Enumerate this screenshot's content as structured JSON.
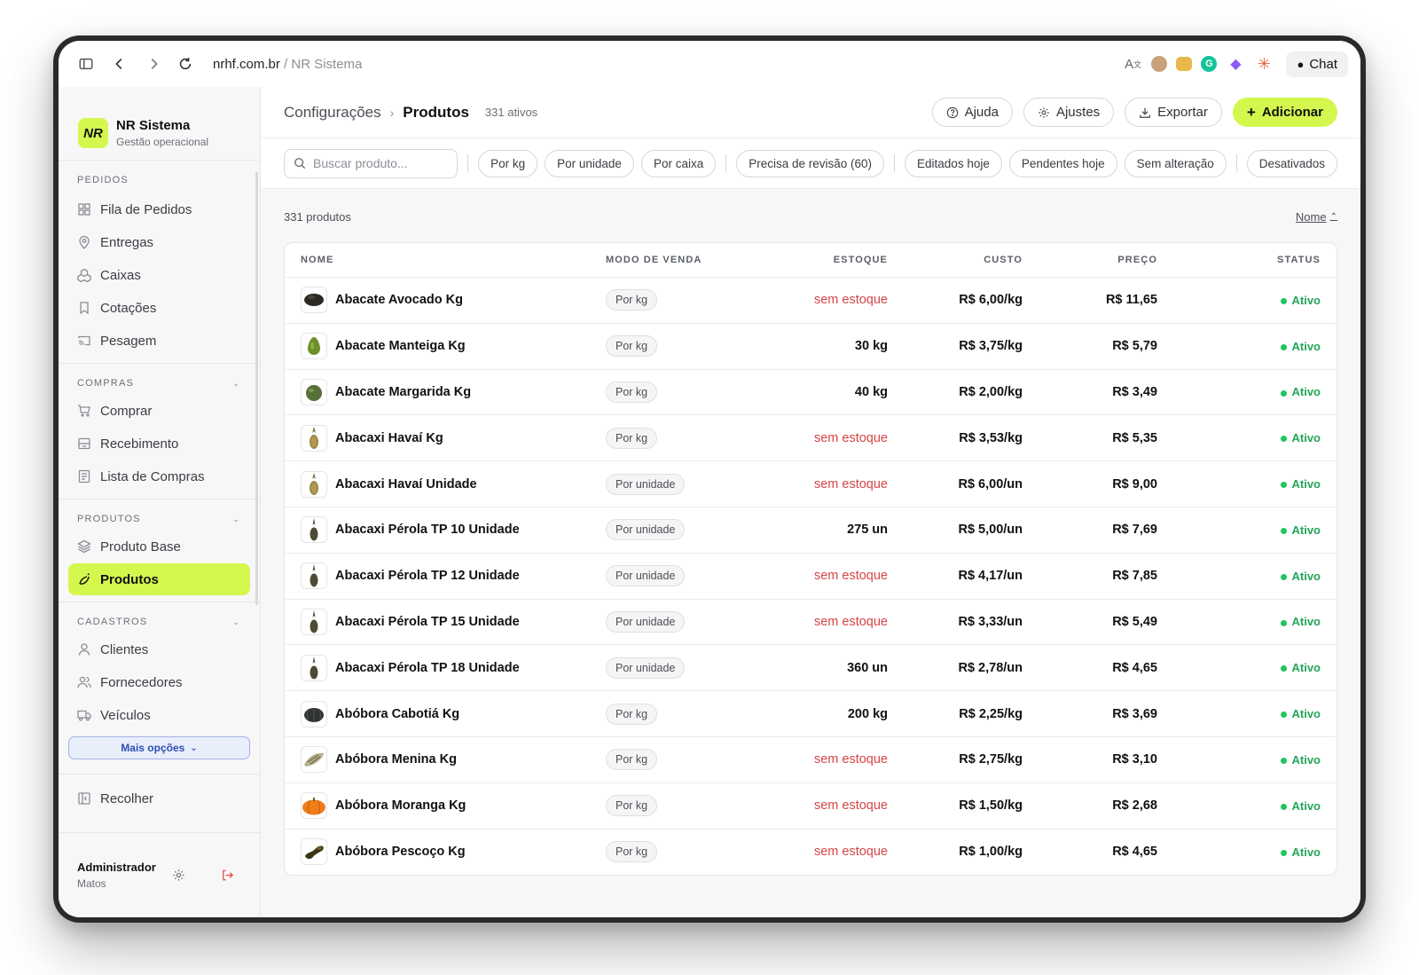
{
  "browser": {
    "domain": "nrhf.com.br",
    "separator": " / ",
    "page": "NR Sistema",
    "chat_label": "Chat"
  },
  "brand": {
    "logo": "NR",
    "name": "NR Sistema",
    "subtitle": "Gestão operacional",
    "accent": "#d4f74e"
  },
  "sidebar": {
    "sections": [
      {
        "title": "PEDIDOS",
        "items": [
          {
            "label": "Fila de Pedidos",
            "icon": "grid-icon"
          },
          {
            "label": "Entregas",
            "icon": "map-pin-icon"
          },
          {
            "label": "Caixas",
            "icon": "boxes-icon"
          },
          {
            "label": "Cotações",
            "icon": "bookmark-icon"
          },
          {
            "label": "Pesagem",
            "icon": "cast-icon"
          }
        ]
      },
      {
        "title": "COMPRAS",
        "items": [
          {
            "label": "Comprar",
            "icon": "cart-icon"
          },
          {
            "label": "Recebimento",
            "icon": "inbox-icon"
          },
          {
            "label": "Lista de Compras",
            "icon": "list-icon"
          }
        ]
      },
      {
        "title": "PRODUTOS",
        "items": [
          {
            "label": "Produto Base",
            "icon": "layers-icon"
          },
          {
            "label": "Produtos",
            "icon": "banana-icon",
            "active": true
          }
        ]
      },
      {
        "title": "CADASTROS",
        "items": [
          {
            "label": "Clientes",
            "icon": "user-icon"
          },
          {
            "label": "Fornecedores",
            "icon": "users-icon"
          },
          {
            "label": "Veículos",
            "icon": "truck-icon"
          }
        ]
      }
    ],
    "more_label": "Mais opções",
    "collapse_label": "Recolher"
  },
  "user": {
    "name": "Administrador",
    "sub": "Matos"
  },
  "header": {
    "crumb_parent": "Configurações",
    "crumb_current": "Produtos",
    "count": "331 ativos",
    "help": "Ajuda",
    "settings": "Ajustes",
    "export": "Exportar",
    "add": "Adicionar"
  },
  "filters": {
    "search_placeholder": "Buscar produto...",
    "chips_a": [
      "Por kg",
      "Por unidade",
      "Por caixa"
    ],
    "chips_b": [
      "Precisa de revisão (60)"
    ],
    "chips_c": [
      "Editados hoje",
      "Pendentes hoje",
      "Sem alteração",
      "Desativados"
    ]
  },
  "list": {
    "total": "331 produtos",
    "sort_label": "Nome"
  },
  "table": {
    "headers": {
      "name": "NOME",
      "mode": "MODO DE VENDA",
      "stock": "ESTOQUE",
      "cost": "CUSTO",
      "price": "PREÇO",
      "status": "STATUS"
    },
    "rows": [
      {
        "name": "Abacate Avocado Kg",
        "mode": "Por kg",
        "stock": "sem estoque",
        "cost": "R$ 6,00/kg",
        "price": "R$ 11,65",
        "status": "Ativo",
        "thumb": "avocado-dark"
      },
      {
        "name": "Abacate Manteiga Kg",
        "mode": "Por kg",
        "stock": "30 kg",
        "cost": "R$ 3,75/kg",
        "price": "R$ 5,79",
        "status": "Ativo",
        "thumb": "avocado-green"
      },
      {
        "name": "Abacate Margarida Kg",
        "mode": "Por kg",
        "stock": "40 kg",
        "cost": "R$ 2,00/kg",
        "price": "R$ 3,49",
        "status": "Ativo",
        "thumb": "avocado-round"
      },
      {
        "name": "Abacaxi Havaí Kg",
        "mode": "Por kg",
        "stock": "sem estoque",
        "cost": "R$ 3,53/kg",
        "price": "R$ 5,35",
        "status": "Ativo",
        "thumb": "pineapple"
      },
      {
        "name": "Abacaxi Havaí Unidade",
        "mode": "Por unidade",
        "stock": "sem estoque",
        "cost": "R$ 6,00/un",
        "price": "R$ 9,00",
        "status": "Ativo",
        "thumb": "pineapple"
      },
      {
        "name": "Abacaxi Pérola TP 10 Unidade",
        "mode": "Por unidade",
        "stock": "275 un",
        "cost": "R$ 5,00/un",
        "price": "R$ 7,69",
        "status": "Ativo",
        "thumb": "pineapple-dark"
      },
      {
        "name": "Abacaxi Pérola TP 12 Unidade",
        "mode": "Por unidade",
        "stock": "sem estoque",
        "cost": "R$ 4,17/un",
        "price": "R$ 7,85",
        "status": "Ativo",
        "thumb": "pineapple-dark"
      },
      {
        "name": "Abacaxi Pérola TP 15 Unidade",
        "mode": "Por unidade",
        "stock": "sem estoque",
        "cost": "R$ 3,33/un",
        "price": "R$ 5,49",
        "status": "Ativo",
        "thumb": "pineapple-dark"
      },
      {
        "name": "Abacaxi Pérola TP 18 Unidade",
        "mode": "Por unidade",
        "stock": "360 un",
        "cost": "R$ 2,78/un",
        "price": "R$ 4,65",
        "status": "Ativo",
        "thumb": "pineapple-dark"
      },
      {
        "name": "Abóbora Cabotiá Kg",
        "mode": "Por kg",
        "stock": "200 kg",
        "cost": "R$ 2,25/kg",
        "price": "R$ 3,69",
        "status": "Ativo",
        "thumb": "pumpkin-dark"
      },
      {
        "name": "Abóbora Menina Kg",
        "mode": "Por kg",
        "stock": "sem estoque",
        "cost": "R$ 2,75/kg",
        "price": "R$ 3,10",
        "status": "Ativo",
        "thumb": "squash-striped"
      },
      {
        "name": "Abóbora Moranga Kg",
        "mode": "Por kg",
        "stock": "sem estoque",
        "cost": "R$ 1,50/kg",
        "price": "R$ 2,68",
        "status": "Ativo",
        "thumb": "pumpkin-orange"
      },
      {
        "name": "Abóbora Pescoço Kg",
        "mode": "Por kg",
        "stock": "sem estoque",
        "cost": "R$ 1,00/kg",
        "price": "R$ 4,65",
        "status": "Ativo",
        "thumb": "squash-neck"
      }
    ]
  }
}
